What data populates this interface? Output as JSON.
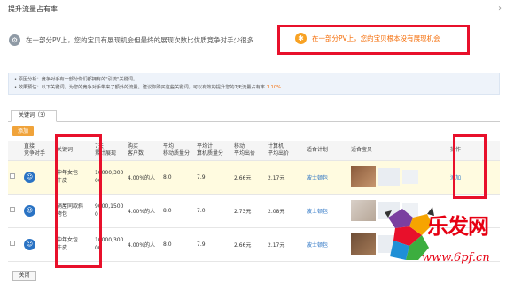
{
  "header": {
    "title": "提升流量占有率"
  },
  "options": [
    {
      "text": "在一部分PV上，您的宝贝有展现机会但最终的展现次数比优质竞争对手少很多",
      "icon": "gear-icon"
    },
    {
      "text": "在一部分PV上，您的宝贝根本没有展现机会",
      "icon": "bulb-icon"
    }
  ],
  "info": {
    "line1": "• 原因分析：竞争对手有一部分你们都拥有的\"引流\"关键词。",
    "line2_prefix": "• 效果预估：以下关键词，为您的竞争对手带来了额外的流量。建议你购买这些关键词，可以有效的提升您的7天流量占有率 ",
    "line2_pct": "1.10%"
  },
  "tab": {
    "label": "关键词（3）"
  },
  "add_label": "添加",
  "close_label": "关闭",
  "table": {
    "headers": [
      "",
      "直接\n竞争对手",
      "关键词",
      "7天\n累计展现",
      "购买\n客户数",
      "平均\n移动质量分",
      "平均计\n算机质量分",
      "移动\n平均出价",
      "计算机\n平均出价",
      "适合计划",
      "适合宝贝",
      "操作"
    ],
    "rows": [
      {
        "keyword": "中年女包\n牛皮",
        "impr": "10000,300\n00",
        "buyers": "4.00%的人",
        "mq": "8.0",
        "cq": "7.9",
        "mbid": "2.66元",
        "cbid": "2.17元",
        "plan": "波士顿包",
        "op": "添加"
      },
      {
        "keyword": "硝屋同款斜\n挎包",
        "impr": "9000,1500\n0",
        "buyers": "4.00%的人",
        "mq": "8.0",
        "cq": "7.0",
        "mbid": "2.73元",
        "cbid": "2.08元",
        "plan": "波士顿包",
        "op": ""
      },
      {
        "keyword": "中年女包\n牛皮",
        "impr": "10000,300\n00",
        "buyers": "4.00%的人",
        "mq": "8.0",
        "cq": "7.9",
        "mbid": "2.66元",
        "cbid": "2.17元",
        "plan": "波士顿包",
        "op": ""
      }
    ]
  },
  "watermark": {
    "brand": "乐发网",
    "site": "www.6pf.cn"
  },
  "colors": {
    "highlight": "#e8102b",
    "accent_orange": "#f46b05",
    "link_blue": "#2a73c4",
    "button_orange": "#f0a33a"
  }
}
